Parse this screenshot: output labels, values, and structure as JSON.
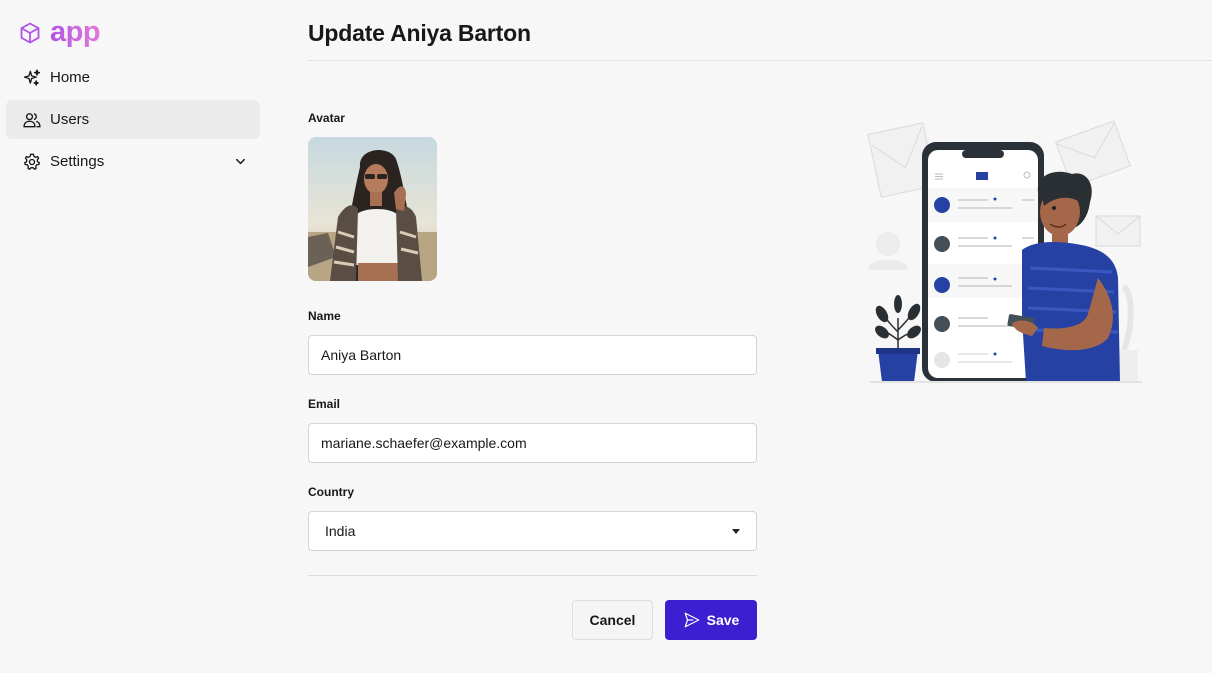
{
  "app": {
    "logo_text": "app"
  },
  "sidebar": {
    "items": [
      {
        "label": "Home",
        "icon": "sparkles-icon"
      },
      {
        "label": "Users",
        "icon": "users-icon",
        "active": true
      },
      {
        "label": "Settings",
        "icon": "gear-icon",
        "expandable": true
      }
    ]
  },
  "page": {
    "title": "Update Aniya Barton"
  },
  "form": {
    "avatar_label": "Avatar",
    "name_label": "Name",
    "name_value": "Aniya Barton",
    "email_label": "Email",
    "email_value": "mariane.schaefer@example.com",
    "country_label": "Country",
    "country_value": "India",
    "cancel_label": "Cancel",
    "save_label": "Save"
  },
  "colors": {
    "accent": "#3b1fd1",
    "logo_gradient_start": "#b054e6",
    "logo_gradient_end": "#e27ad8",
    "illustration_blue": "#2541a3"
  }
}
